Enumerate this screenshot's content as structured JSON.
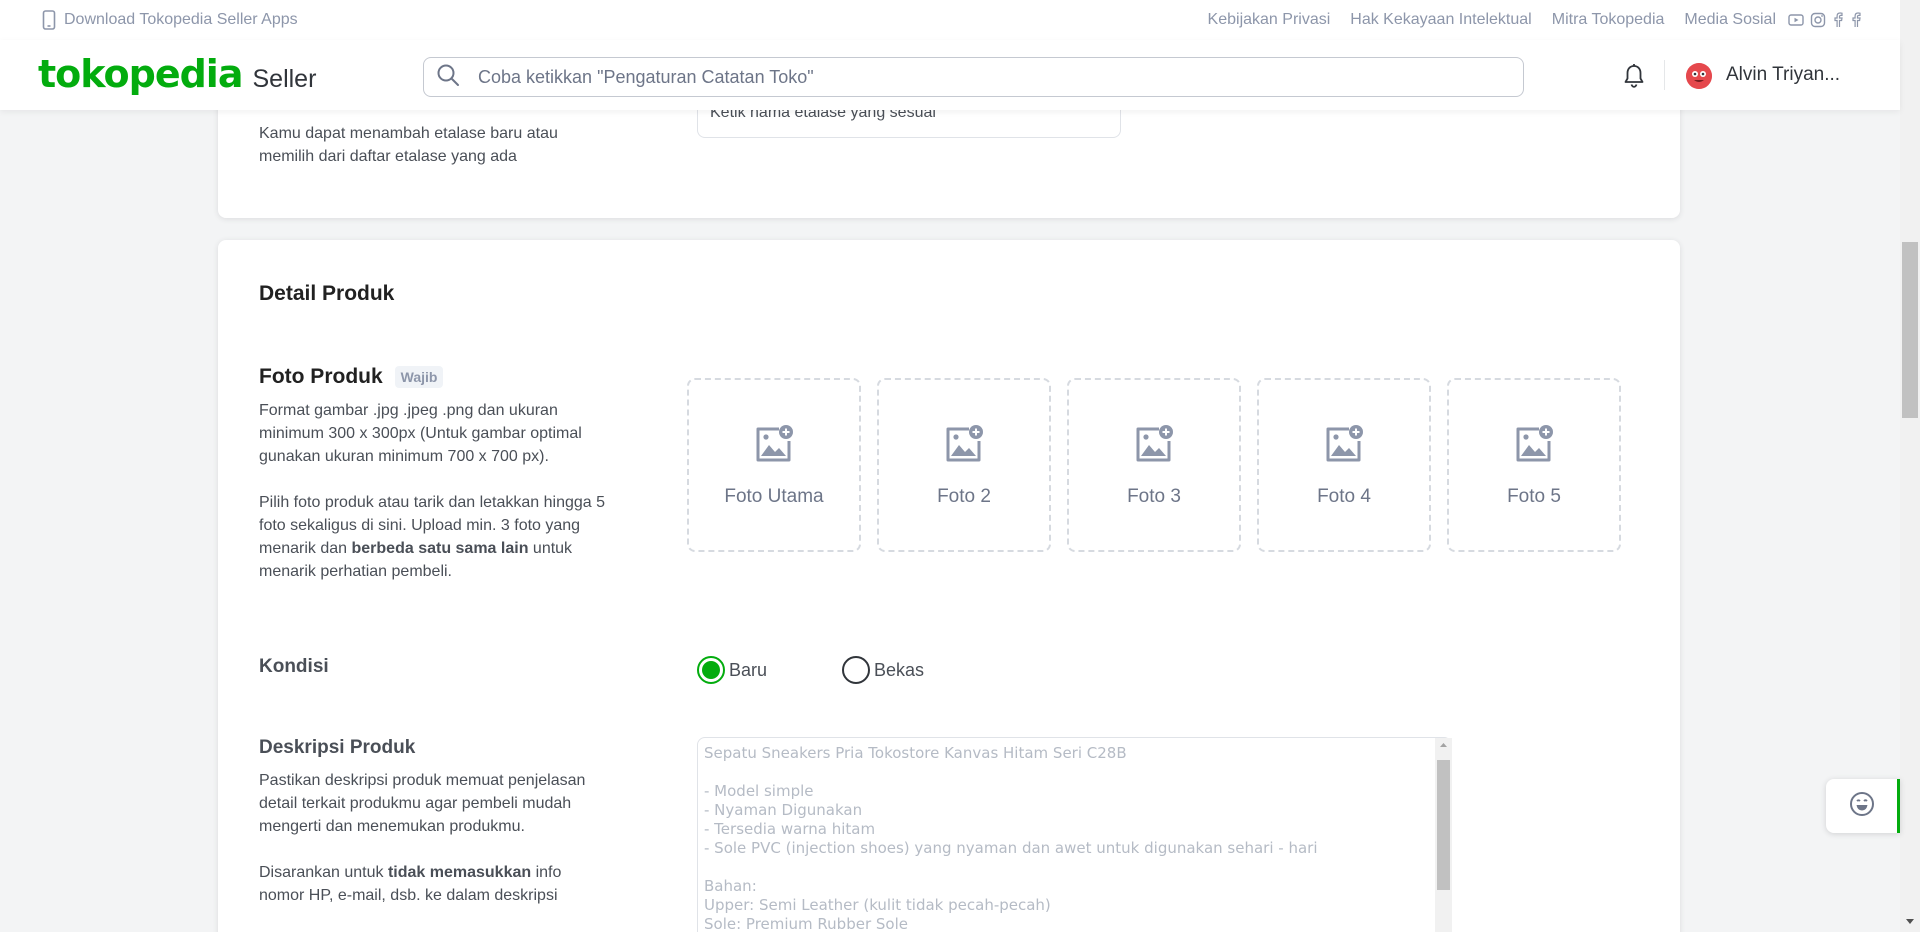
{
  "topbar": {
    "download_label": "Download Tokopedia Seller Apps",
    "links": [
      "Kebijakan Privasi",
      "Hak Kekayaan Intelektual",
      "Mitra Tokopedia",
      "Media Sosial"
    ],
    "social_icons": [
      "youtube-icon",
      "instagram-icon",
      "facebook-icon",
      "facebook-icon"
    ]
  },
  "header": {
    "logo": "tokopedia",
    "logo_suffix": "Seller",
    "search_placeholder": "Coba ketikkan \"Pengaturan Catatan Toko\"",
    "user_name": "Alvin Triyan...",
    "brand_color": "#03ac0e"
  },
  "etalase": {
    "description": "Kamu dapat menambah etalase baru atau memilih dari daftar etalase yang ada",
    "input_value": "Ketik nama etalase yang sesuai"
  },
  "detail": {
    "title": "Detail Produk",
    "foto": {
      "label": "Foto Produk",
      "badge": "Wajib",
      "desc1": "Format gambar .jpg .jpeg .png dan ukuran minimum 300 x 300px (Untuk gambar optimal gunakan ukuran minimum 700 x 700 px).",
      "desc2_pre": "Pilih foto produk atau tarik dan letakkan hingga 5 foto sekaligus di sini. Upload min. 3 foto yang menarik dan ",
      "desc2_bold": "berbeda satu sama lain",
      "desc2_post": " untuk menarik perhatian pembeli.",
      "slots": [
        "Foto Utama",
        "Foto 2",
        "Foto 3",
        "Foto 4",
        "Foto 5"
      ]
    },
    "kondisi": {
      "label": "Kondisi",
      "options": [
        "Baru",
        "Bekas"
      ],
      "selected": "Baru"
    },
    "deskripsi": {
      "label": "Deskripsi Produk",
      "help1": "Pastikan deskripsi produk memuat penjelasan detail terkait produkmu agar pembeli mudah mengerti dan menemukan produkmu.",
      "help2_pre": "Disarankan untuk ",
      "help2_bold": "tidak memasukkan",
      "help2_post": " info nomor HP, e-mail, dsb. ke dalam deskripsi",
      "placeholder": "Sepatu Sneakers Pria Tokostore Kanvas Hitam Seri C28B\n\n- Model simple\n- Nyaman Digunakan\n- Tersedia warna hitam\n- Sole PVC (injection shoes) yang nyaman dan awet untuk digunakan sehari - hari\n\nBahan:\nUpper: Semi Leather (kulit tidak pecah-pecah)\nSole: Premium Rubber Sole"
    }
  }
}
